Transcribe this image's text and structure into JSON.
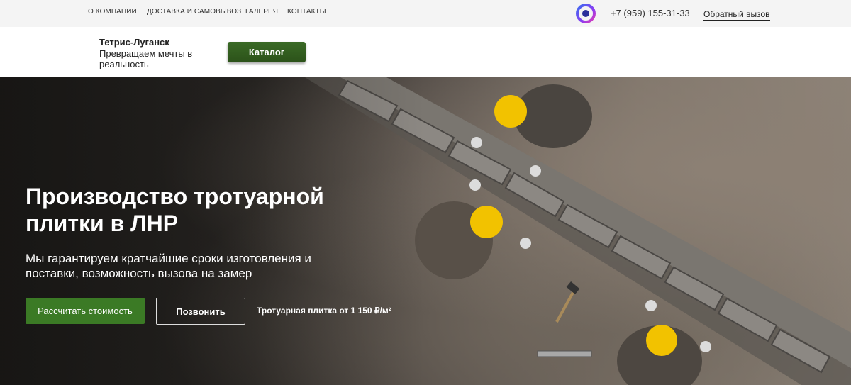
{
  "topnav": {
    "items": [
      "О КОМПАНИИ",
      "ДОСТАВКА И САМОВЫВОЗ",
      "ГАЛЕРЕЯ",
      "КОНТАКТЫ"
    ]
  },
  "contact": {
    "phone": "+7 (959) 155-31-33",
    "callback_label": "Обратный вызов"
  },
  "header": {
    "brand": "Тетрис-Луганск",
    "tagline": "Превращаем мечты в реальность",
    "catalog_label": "Каталог"
  },
  "hero": {
    "title": "Производство тротуарной плитки в ЛНР",
    "subtitle": "Мы гарантируем кратчайшие сроки изготовления и поставки, возможность вызова на замер",
    "calc_button": "Рассчитать стоимость",
    "call_button": "Позвонить",
    "price_note": "Тротуарная плитка от 1 150 ₽/м²"
  },
  "colors": {
    "accent_green": "#3b7a25",
    "catalog_green": "#2c5219",
    "helmet_yellow": "#f2c200"
  },
  "icons": {
    "messenger": "chat-bubble-icon"
  }
}
